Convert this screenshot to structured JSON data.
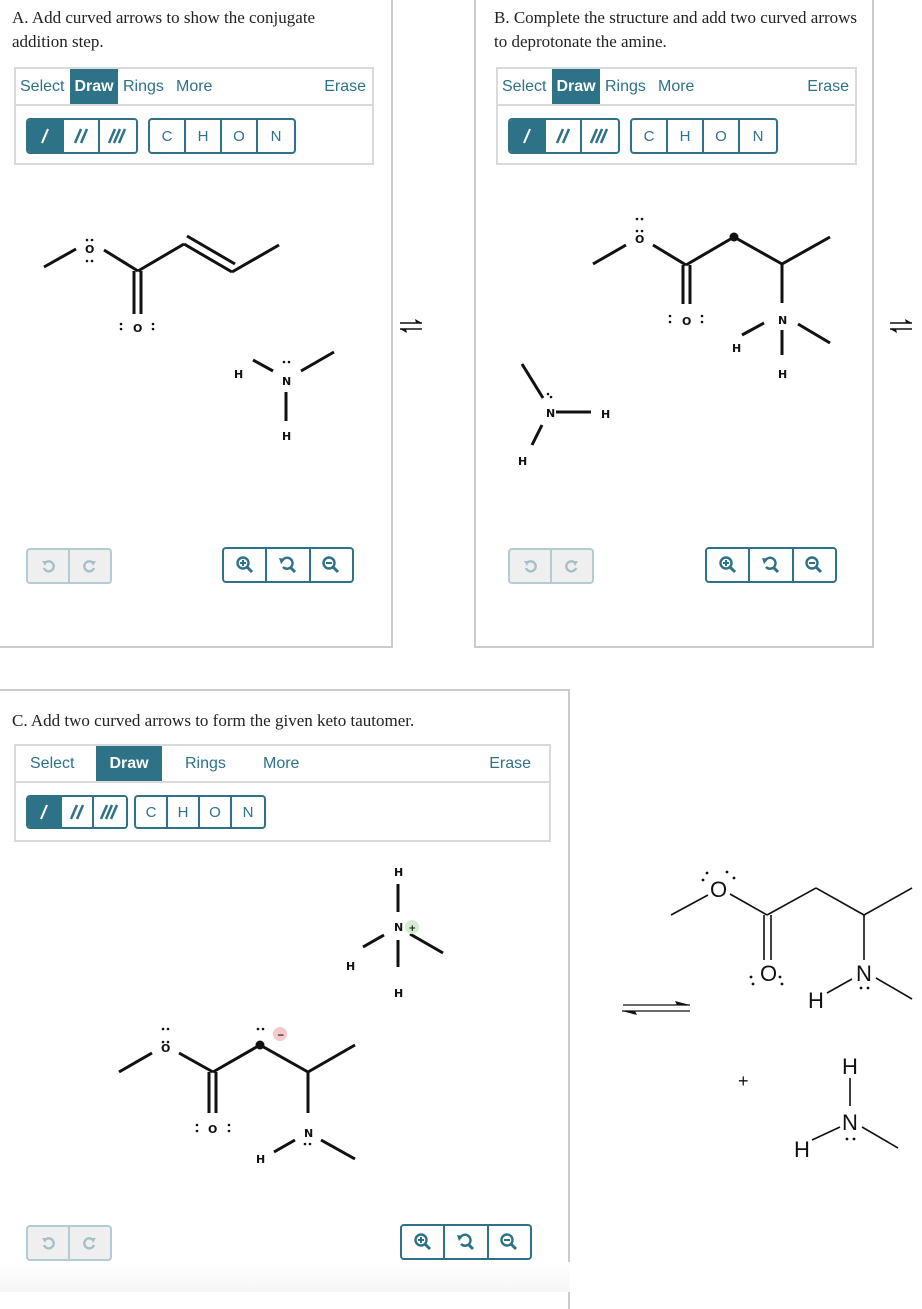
{
  "panels": {
    "A": {
      "prompt": "A. Add curved arrows to show the conjugate addition step.",
      "toolbar": {
        "tabs": [
          "Select",
          "Draw",
          "Rings",
          "More"
        ],
        "active_tab": "Draw",
        "erase": "Erase",
        "bonds": [
          "single-bond",
          "double-bond",
          "triple-bond"
        ],
        "active_bond": "single-bond",
        "atoms": [
          "C",
          "H",
          "O",
          "N"
        ]
      },
      "molecules": {
        "ester_atoms": [
          "O",
          "O"
        ],
        "amine_atoms": [
          "H",
          "N",
          "H"
        ]
      },
      "undo_icon": "undo-icon",
      "redo_icon": "redo-icon",
      "zoom_buttons": [
        "zoom-in-icon",
        "zoom-reset-icon",
        "zoom-out-icon"
      ]
    },
    "B": {
      "prompt": "B. Complete the structure and add two curved arrows to deprotonate the amine.",
      "toolbar": {
        "tabs": [
          "Select",
          "Draw",
          "Rings",
          "More"
        ],
        "active_tab": "Draw",
        "erase": "Erase",
        "bonds": [
          "single-bond",
          "double-bond",
          "triple-bond"
        ],
        "active_bond": "single-bond",
        "atoms": [
          "C",
          "H",
          "O",
          "N"
        ]
      },
      "molecules": {
        "ester_atoms": [
          "O",
          "O",
          "N",
          "H",
          "H"
        ],
        "amine_atoms": [
          "N",
          "H",
          "H"
        ]
      }
    },
    "C": {
      "prompt": "C. Add two curved arrows to form the given keto tautomer.",
      "toolbar": {
        "tabs": [
          "Select",
          "Draw",
          "Rings",
          "More"
        ],
        "active_tab": "Draw",
        "erase": "Erase",
        "bonds": [
          "single-bond",
          "double-bond",
          "triple-bond"
        ],
        "active_bond": "single-bond",
        "atoms": [
          "C",
          "H",
          "O",
          "N"
        ]
      },
      "charges": {
        "ammonium": "+",
        "carbanion": "−"
      }
    }
  },
  "equilibrium_symbol": "⇌",
  "answer": {
    "plus": "+",
    "labels": {
      "o": "O",
      "n": "N",
      "h": "H"
    }
  },
  "colors": {
    "accent": "#2d7287",
    "border": "#cccccc",
    "positive": "#d6ecd2",
    "negative": "#f6caca"
  }
}
